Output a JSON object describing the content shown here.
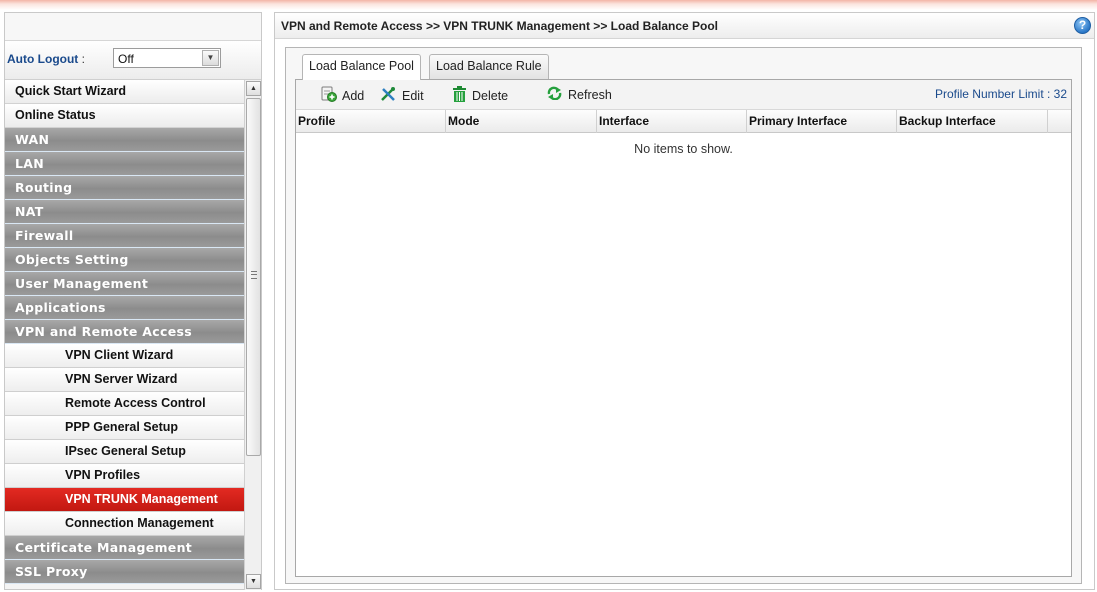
{
  "sidebar": {
    "auto_logout_label": "Auto Logout",
    "auto_logout_colon": " :",
    "auto_logout_value": "Off",
    "items": [
      {
        "label": "Quick Start Wizard"
      },
      {
        "label": "Online Status"
      },
      {
        "label": "WAN"
      },
      {
        "label": "LAN"
      },
      {
        "label": "Routing"
      },
      {
        "label": "NAT"
      },
      {
        "label": "Firewall"
      },
      {
        "label": "Objects Setting"
      },
      {
        "label": "User Management"
      },
      {
        "label": "Applications"
      },
      {
        "label": "VPN and Remote Access"
      },
      {
        "label": "VPN Client Wizard"
      },
      {
        "label": "VPN Server Wizard"
      },
      {
        "label": "Remote Access Control"
      },
      {
        "label": "PPP General Setup"
      },
      {
        "label": "IPsec General Setup"
      },
      {
        "label": "VPN Profiles"
      },
      {
        "label": "VPN TRUNK Management"
      },
      {
        "label": "Connection Management"
      },
      {
        "label": "Certificate Management"
      },
      {
        "label": "SSL Proxy"
      }
    ],
    "active_item": "VPN TRUNK Management"
  },
  "header": {
    "breadcrumb": "VPN and Remote Access >> VPN TRUNK Management >> Load Balance Pool",
    "help_glyph": "?"
  },
  "tabs": [
    {
      "label": "Load Balance Pool",
      "active": true
    },
    {
      "label": "Load Balance Rule",
      "active": false
    }
  ],
  "toolbar": {
    "add_label": "Add",
    "edit_label": "Edit",
    "delete_label": "Delete",
    "refresh_label": "Refresh",
    "profile_limit": "Profile Number Limit : 32"
  },
  "table": {
    "columns": [
      "Profile",
      "Mode",
      "Interface",
      "Primary Interface",
      "Backup Interface"
    ],
    "empty_message": "No items to show."
  },
  "colors": {
    "active_menu": "#d1201a",
    "menu_group": "#9a9a9a",
    "link_blue": "#1a4a8c"
  }
}
